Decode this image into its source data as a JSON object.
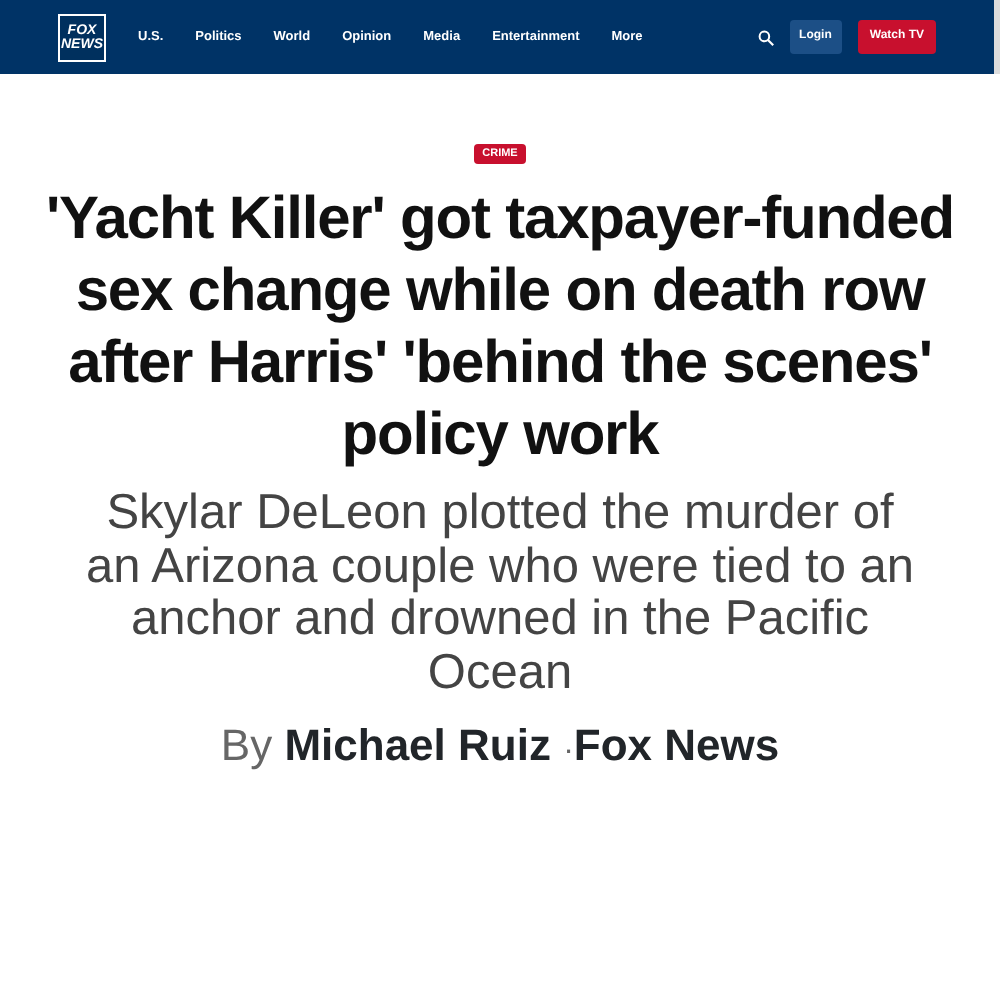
{
  "header": {
    "logo": {
      "line_1": "FOX",
      "line_2": "NEWS"
    },
    "nav": [
      "U.S.",
      "Politics",
      "World",
      "Opinion",
      "Media",
      "Entertainment",
      "More"
    ],
    "login": "Login",
    "watch": "Watch TV"
  },
  "article": {
    "category": "CRIME",
    "headline": "'Yacht Killer' got taxpayer-funded sex change while on death row after Harris' 'behind the scenes' policy work",
    "subhead": "Skylar DeLeon plotted the murder of an Arizona couple who were tied to an anchor and drowned in the Pacific Ocean",
    "byline": {
      "prefix": "By",
      "author": "Michael Ruiz",
      "separator": "·",
      "outlet": "Fox News"
    }
  }
}
